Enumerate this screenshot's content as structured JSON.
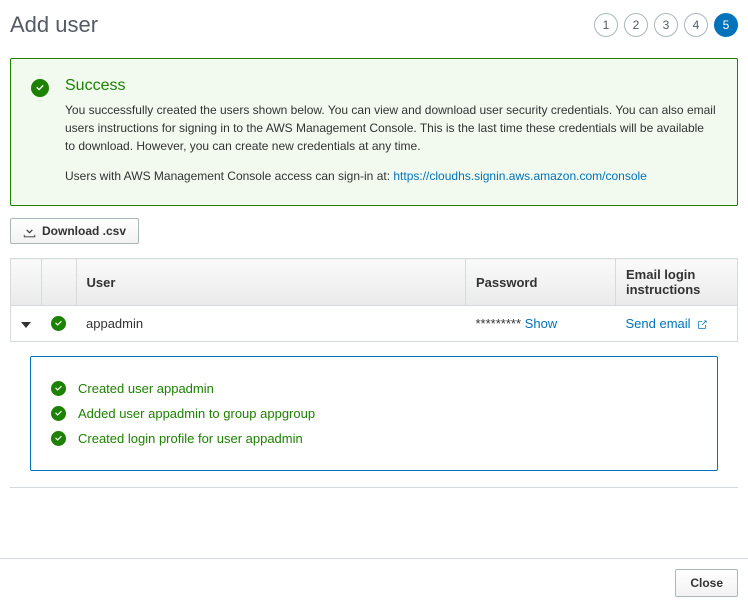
{
  "header": {
    "title": "Add user",
    "steps": [
      "1",
      "2",
      "3",
      "4",
      "5"
    ],
    "active_step": 4
  },
  "alert": {
    "title": "Success",
    "body1": "You successfully created the users shown below. You can view and download user security credentials. You can also email users instructions for signing in to the AWS Management Console. This is the last time these credentials will be available to download. However, you can create new credentials at any time.",
    "body2_prefix": "Users with AWS Management Console access can sign-in at: ",
    "body2_link": "https://cloudhs.signin.aws.amazon.com/console"
  },
  "download_label": "Download .csv",
  "table": {
    "headers": {
      "user": "User",
      "password": "Password",
      "email": "Email login instructions"
    },
    "row": {
      "user": "appadmin",
      "password_mask": "*********",
      "show_label": "Show",
      "send_email_label": "Send email"
    }
  },
  "details": {
    "line1": "Created user appadmin",
    "line2": "Added user appadmin to group appgroup",
    "line3": "Created login profile for user appadmin"
  },
  "footer": {
    "close": "Close"
  }
}
